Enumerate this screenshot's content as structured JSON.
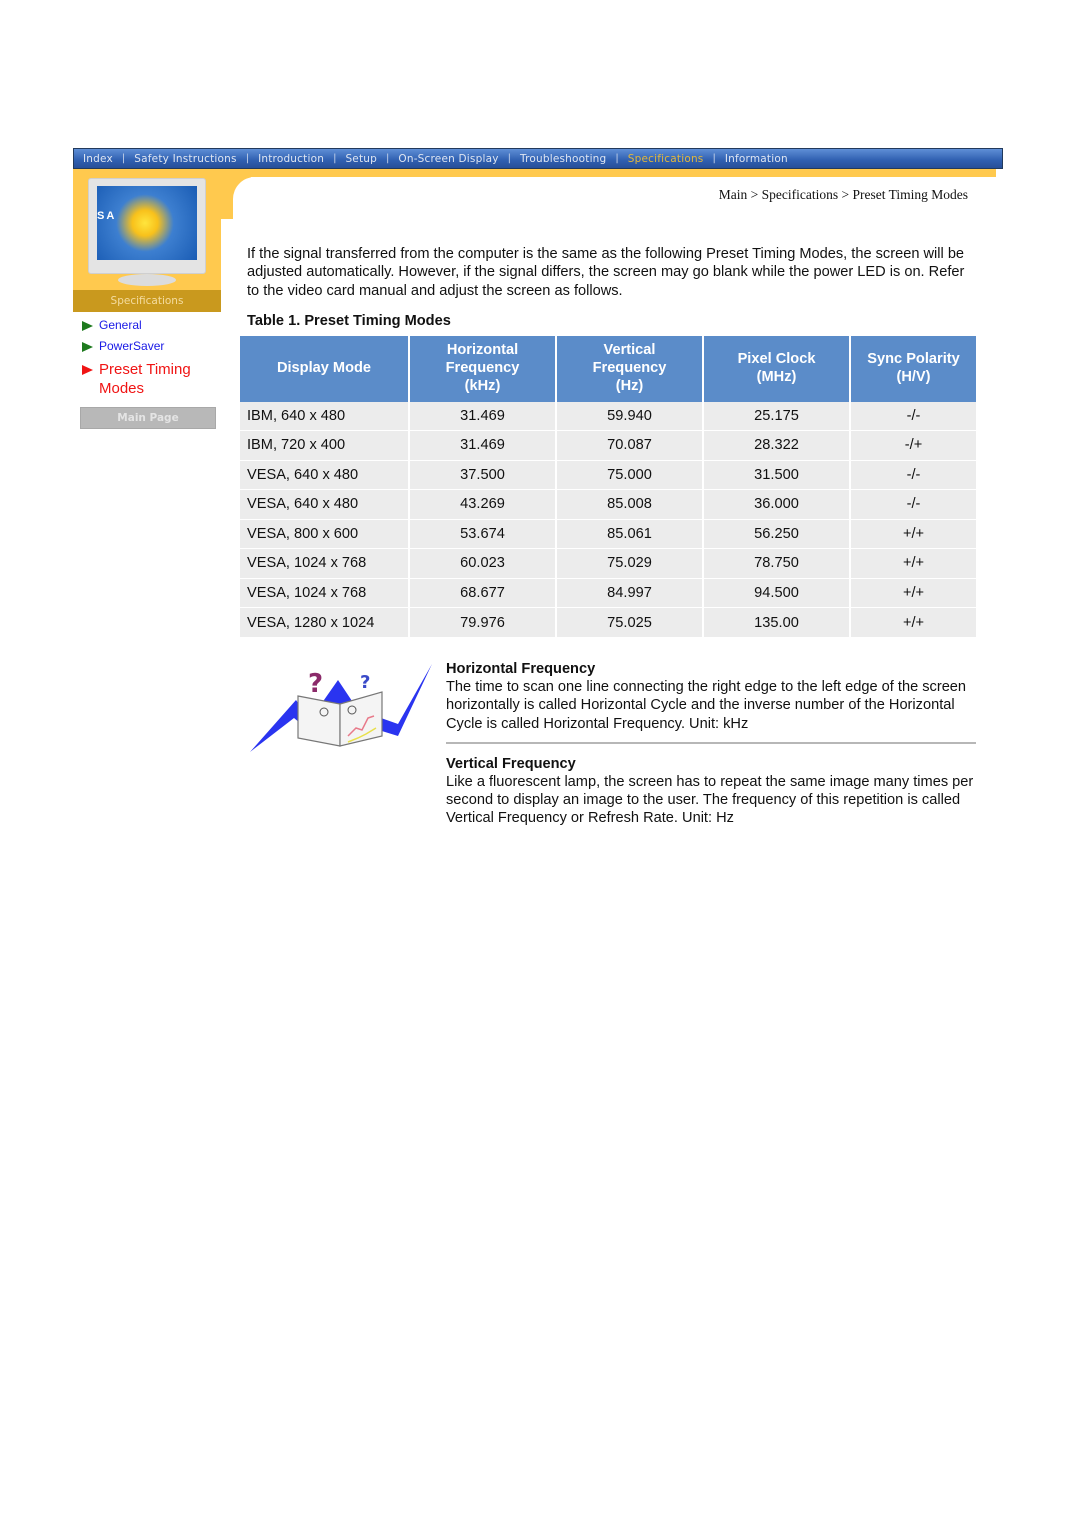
{
  "topnav": {
    "items": [
      {
        "label": "Index",
        "active": false
      },
      {
        "label": "Safety Instructions",
        "active": false
      },
      {
        "label": "Introduction",
        "active": false
      },
      {
        "label": "Setup",
        "active": false
      },
      {
        "label": "On-Screen Display",
        "active": false
      },
      {
        "label": "Troubleshooting",
        "active": false
      },
      {
        "label": "Specifications",
        "active": true
      },
      {
        "label": "Information",
        "active": false
      }
    ],
    "separator": "|"
  },
  "sidebar": {
    "monitor_brand": "SA",
    "section_label": "Specifications",
    "items": [
      {
        "label": "General",
        "active": false
      },
      {
        "label": "PowerSaver",
        "active": false
      },
      {
        "label": "Preset Timing Modes",
        "active": true
      }
    ],
    "main_page_label": "Main Page"
  },
  "breadcrumb": "Main > Specifications > Preset Timing Modes",
  "intro": "If the signal transferred from the computer is the same as the following Preset Timing Modes, the screen will be adjusted automatically. However, if the signal differs, the screen may go blank while the power LED is on. Refer to the video card manual and adjust the screen as follows.",
  "table": {
    "caption": "Table 1. Preset Timing Modes",
    "headers": [
      {
        "line1": "Display Mode",
        "line2": "",
        "line3": ""
      },
      {
        "line1": "Horizontal",
        "line2": "Frequency",
        "line3": "(kHz)"
      },
      {
        "line1": "Vertical",
        "line2": "Frequency",
        "line3": "(Hz)"
      },
      {
        "line1": "Pixel Clock",
        "line2": "(MHz)",
        "line3": ""
      },
      {
        "line1": "Sync Polarity",
        "line2": "(H/V)",
        "line3": ""
      }
    ],
    "rows": [
      [
        "IBM, 640 x 480",
        "31.469",
        "59.940",
        "25.175",
        "-/-"
      ],
      [
        "IBM, 720 x 400",
        "31.469",
        "70.087",
        "28.322",
        "-/+"
      ],
      [
        "VESA, 640 x 480",
        "37.500",
        "75.000",
        "31.500",
        "-/-"
      ],
      [
        "VESA, 640 x 480",
        "43.269",
        "85.008",
        "36.000",
        "-/-"
      ],
      [
        "VESA, 800 x 600",
        "53.674",
        "85.061",
        "56.250",
        "+/+"
      ],
      [
        "VESA, 1024 x 768",
        "60.023",
        "75.029",
        "78.750",
        "+/+"
      ],
      [
        "VESA, 1024 x 768",
        "68.677",
        "84.997",
        "94.500",
        "+/+"
      ],
      [
        "VESA, 1280 x 1024",
        "79.976",
        "75.025",
        "135.00",
        "+/+"
      ]
    ]
  },
  "definitions": [
    {
      "title": "Horizontal Frequency",
      "body": "The time to scan one line connecting the right edge to the left edge of the screen horizontally is called Horizontal Cycle and the inverse number of the Horizontal Cycle is called Horizontal Frequency. Unit: kHz"
    },
    {
      "title": "Vertical Frequency",
      "body": "Like a fluorescent lamp, the screen has to repeat the same image many times per second to display an image to the user. The frequency of this repetition is called Vertical Frequency or Refresh Rate. Unit: Hz"
    }
  ],
  "colors": {
    "nav_blue": "#2f5fb0",
    "nav_active": "#e2b73c",
    "accent_yellow": "#ffc94e",
    "table_header": "#5b8cc9",
    "link_blue": "#1919e6",
    "active_red": "#f01414"
  }
}
